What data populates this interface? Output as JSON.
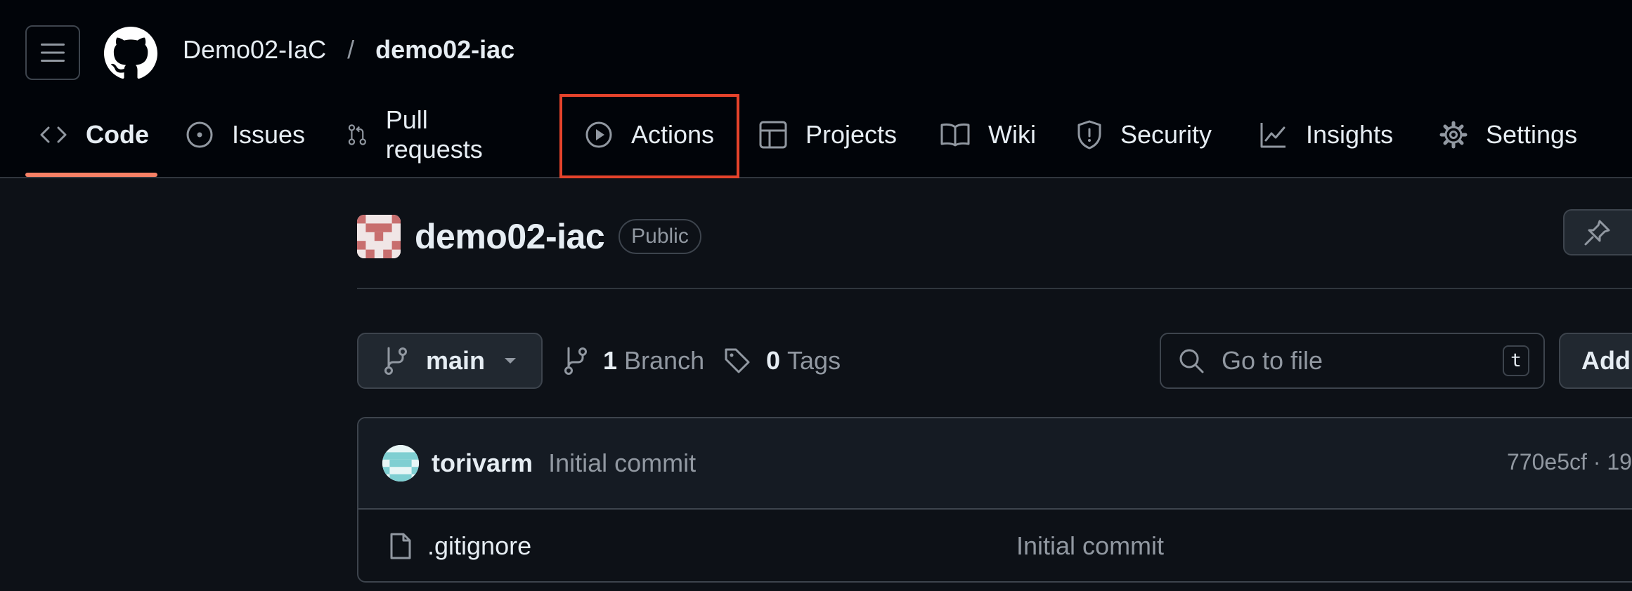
{
  "header": {
    "owner": "Demo02-IaC",
    "separator": "/",
    "repo": "demo02-iac"
  },
  "nav": {
    "tabs": [
      {
        "label": "Code",
        "icon": "code-icon",
        "active": true
      },
      {
        "label": "Issues",
        "icon": "issue-opened-icon"
      },
      {
        "label": "Pull requests",
        "icon": "git-pull-request-icon"
      },
      {
        "label": "Actions",
        "icon": "play-icon",
        "highlighted": true
      },
      {
        "label": "Projects",
        "icon": "table-icon"
      },
      {
        "label": "Wiki",
        "icon": "book-icon"
      },
      {
        "label": "Security",
        "icon": "shield-icon"
      },
      {
        "label": "Insights",
        "icon": "graph-icon"
      },
      {
        "label": "Settings",
        "icon": "gear-icon"
      }
    ]
  },
  "repo": {
    "name": "demo02-iac",
    "visibility": "Public"
  },
  "toolbar": {
    "branch": "main",
    "branch_count": "1",
    "branch_label": "Branch",
    "tag_count": "0",
    "tag_label": "Tags",
    "search_placeholder": "Go to file",
    "search_shortcut": "t",
    "add_label": "Add"
  },
  "latest_commit": {
    "author": "torivarm",
    "message": "Initial commit",
    "meta": "770e5cf · 19"
  },
  "files": [
    {
      "name": ".gitignore",
      "commit": "Initial commit"
    }
  ],
  "colors": {
    "background": "#0d1117",
    "header": "#010409",
    "accent_underline": "#f78166",
    "highlight_box": "#e5432b"
  }
}
